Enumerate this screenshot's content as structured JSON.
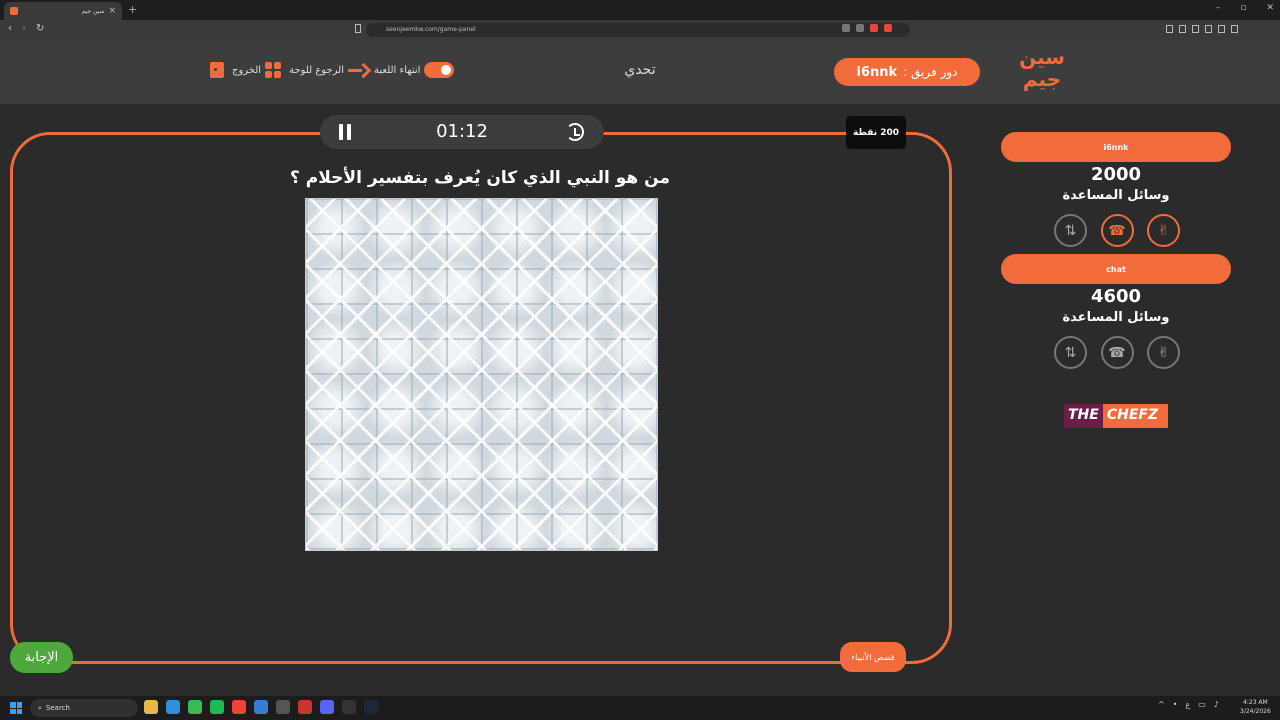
{
  "browser": {
    "tab_title": "سين جيم",
    "url": "seenjeemkw.com/game-panel",
    "new_tab": "+",
    "win_min": "–",
    "win_max": "▫",
    "win_close": "✕"
  },
  "header": {
    "logo_text": "سين جيم",
    "turn_label": "دور فريق :",
    "turn_team": "i6nnk",
    "challenge": "تحدي",
    "end_game": "انتهاء اللعبة",
    "back_to_board": "الرجوع للوحة",
    "exit": "الخروج"
  },
  "question": {
    "timer": "01:12",
    "points": "200 نقطة",
    "text": "من هو النبي الذي كان يُعرف بتفسير الأحلام ؟",
    "category": "قصص الأنبياء",
    "answer_button": "الإجابة"
  },
  "teams": [
    {
      "name": "i6nnk",
      "score": "2000",
      "aids_label": "وسائل المساعدة",
      "aids_active": [
        false,
        true,
        true
      ]
    },
    {
      "name": "chat",
      "score": "4600",
      "aids_label": "وسائل المساعدة",
      "aids_active": [
        false,
        false,
        false
      ]
    }
  ],
  "sponsor": {
    "part1": "THE",
    "part2": "CHEFZ"
  },
  "taskbar": {
    "search_placeholder": "Search",
    "time": "4:23 AM",
    "date": "3/24/2026"
  },
  "colors": {
    "accent": "#f26b3a",
    "answer": "#4fa83d",
    "background": "#2b2b2b"
  }
}
